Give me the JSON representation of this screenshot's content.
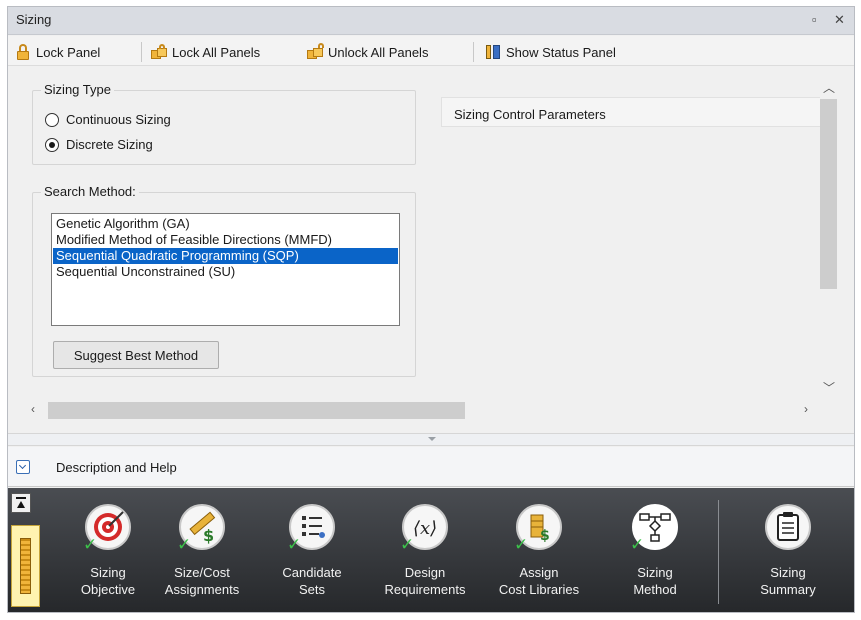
{
  "window": {
    "title": "Sizing"
  },
  "toolbar": {
    "lock_panel": "Lock Panel",
    "lock_all": "Lock All Panels",
    "unlock_all": "Unlock All Panels",
    "show_status": "Show Status Panel"
  },
  "sizing_type": {
    "legend": "Sizing Type",
    "continuous": "Continuous Sizing",
    "discrete": "Discrete Sizing",
    "selected": "discrete"
  },
  "search_method": {
    "legend": "Search Method:",
    "options": [
      "Genetic Algorithm (GA)",
      "Modified Method of Feasible Directions (MMFD)",
      "Sequential Quadratic Programming (SQP)",
      "Sequential Unconstrained (SU)"
    ],
    "selected": "Sequential Quadratic Programming (SQP)",
    "suggest_button": "Suggest Best Method"
  },
  "params": {
    "title": "Sizing Control Parameters"
  },
  "description": {
    "label": "Description and Help"
  },
  "ribbon": {
    "items": [
      {
        "line1": "Sizing",
        "line2": "Objective",
        "icon": "target-icon"
      },
      {
        "line1": "Size/Cost",
        "line2": "Assignments",
        "icon": "ruler-dollar-icon"
      },
      {
        "line1": "Candidate",
        "line2": "Sets",
        "icon": "list-icon"
      },
      {
        "line1": "Design",
        "line2": "Requirements",
        "icon": "variable-x-icon"
      },
      {
        "line1": "Assign",
        "line2": "Cost Libraries",
        "icon": "cost-library-icon"
      },
      {
        "line1": "Sizing",
        "line2": "Method",
        "icon": "flowchart-icon"
      },
      {
        "line1": "Sizing",
        "line2": "Summary",
        "icon": "clipboard-icon"
      }
    ]
  },
  "colors": {
    "selection": "#0a64c8",
    "ribbon_bg": "#3a3c40",
    "check": "#3cc24a"
  }
}
